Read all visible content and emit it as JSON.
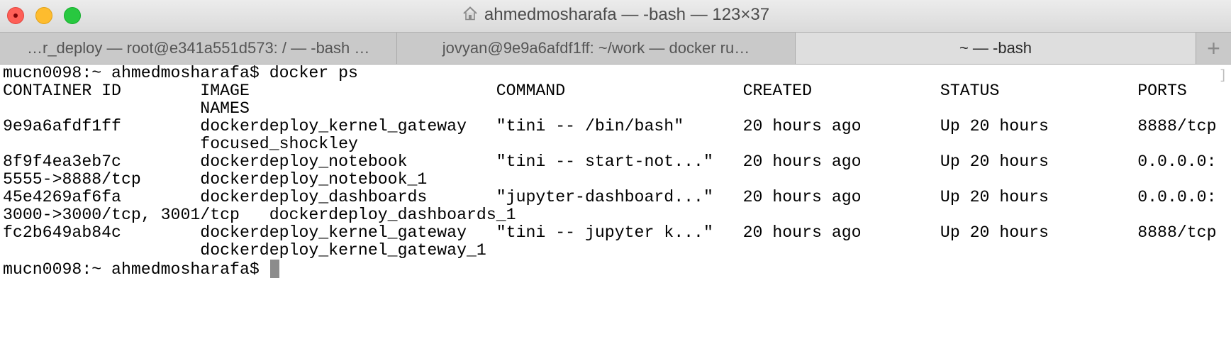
{
  "window": {
    "title": "ahmedmosharafa — -bash — 123×37"
  },
  "tabs": [
    {
      "label": "…r_deploy — root@e341a551d573: / — -bash  …"
    },
    {
      "label": "jovyan@9e9a6afdf1ff: ~/work — docker ru…"
    },
    {
      "label": "~ — -bash"
    }
  ],
  "new_tab_label": "+",
  "terminal": {
    "prompt": "mucn0098:~ ahmedmosharafa$ ",
    "command": "docker ps",
    "output_lines": [
      "CONTAINER ID        IMAGE                         COMMAND                  CREATED             STATUS              PORTS",
      "                    NAMES",
      "9e9a6afdf1ff        dockerdeploy_kernel_gateway   \"tini -- /bin/bash\"      20 hours ago        Up 20 hours         8888/tcp",
      "                    focused_shockley",
      "8f9f4ea3eb7c        dockerdeploy_notebook         \"tini -- start-not...\"   20 hours ago        Up 20 hours         0.0.0.0:",
      "5555->8888/tcp      dockerdeploy_notebook_1",
      "45e4269af6fa        dockerdeploy_dashboards       \"jupyter-dashboard...\"   20 hours ago        Up 20 hours         0.0.0.0:",
      "3000->3000/tcp, 3001/tcp   dockerdeploy_dashboards_1",
      "fc2b649ab84c        dockerdeploy_kernel_gateway   \"tini -- jupyter k...\"   20 hours ago        Up 20 hours         8888/tcp",
      "                    dockerdeploy_kernel_gateway_1"
    ],
    "final_prompt": "mucn0098:~ ahmedmosharafa$ "
  }
}
